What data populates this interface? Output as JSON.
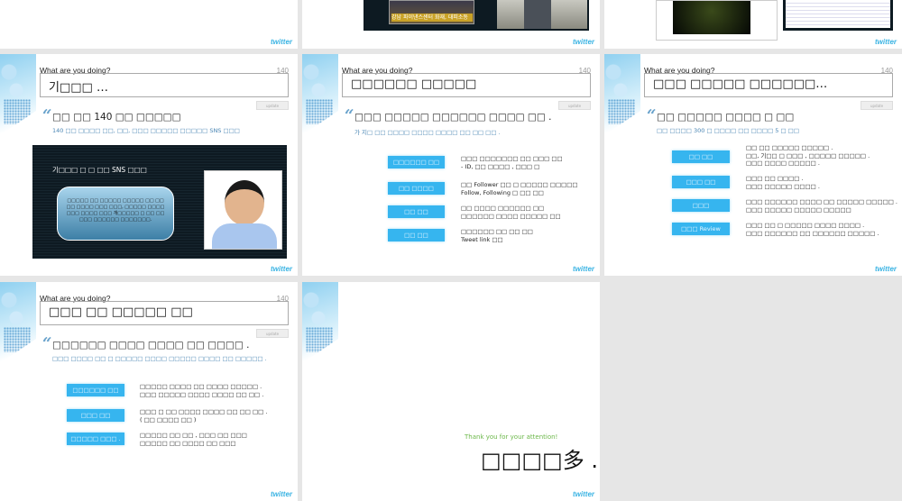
{
  "common": {
    "prompt": "What are you doing?",
    "counter": "140",
    "update": "update",
    "logo": "twitter"
  },
  "top_row": {
    "image_caption": "강남 파이낸스센터 화재, 대피소동"
  },
  "slide4": {
    "input": "기□□□ …",
    "heading": "□□ □□ 140 □□ □□□□□",
    "sub": "140 □□ □□□□ □□, □□, □□□ □□□□□ □□□□□ SNS □□□",
    "inner_title": "기□□□ □ □ □□ SNS □□□",
    "bubble": "□□□□□ □□ □□□□□ □□□□□ □□ □□ □□ □□□□ □□□ □□□, □□□□□ □□□□ □□□ □□□□ □□□ 개□□□□□ □ □□ □□ □□□ □□□□□□ □□□□□□□."
  },
  "slide5": {
    "input": "□□□□□□ □□□□□",
    "heading": "□□□ □□□□□ □□□□□□ □□□□ □□ .",
    "sub": "가 지□ □□ □□□□ □□□□ □□□□ □□ □□ □□ .",
    "rows": [
      {
        "btn": "□□□□□□ □□",
        "l1": "□□□ □□□□□□□ □□ □□□ □□",
        "l2": "- ID, □□ □□□□ , □□□ □"
      },
      {
        "btn": "□□ □□□□",
        "l1": "□□ Follower □□ □ □□□□□ □□□□□",
        "l2": "Follow, Following □ □□ □□"
      },
      {
        "btn": "□□ □□",
        "l1": "□□ □□□□ □□□□□□ □□",
        "l2": "□□□□□□ □□□□ □□□□□ □□"
      },
      {
        "btn": "□□ □□",
        "l1": "□□□□□□ □□ □□ □□",
        "l2": "Tweet link □□"
      }
    ]
  },
  "slide6": {
    "input": "□□□ □□□□□ □□□□□□…",
    "heading": "□□ □□□□□ □□□□ □ □□",
    "sub": "□□ □□□□ 300 □ □□□□ □□ □□□□ 5 □ □□",
    "rows": [
      {
        "btn": "□□ □□",
        "l1": "□□ □□ □□□□□ □□□□□ .",
        "l2": "□□, 기□□ □ □□□ , □□□□□ □□□□□ .",
        "l3": "□□□ □□□□ □□□□□ ."
      },
      {
        "btn": "□□□ □□",
        "l1": "□□□ □□ □□□□ .",
        "l2": "□□□ □□□□□ □□□□ ."
      },
      {
        "btn": "□□□",
        "l1": "□□□ □□□□□□ □□□□ □□ □□□□□ □□□□□ .",
        "l2": "□□□ □□□□□ □□□□□ □□□□□"
      },
      {
        "btn": "□□□ Review",
        "l1": "□□□ □□ □ □□□□□ □□□□ □□□□ .",
        "l2": "□□□ □□□□□□ □□ □□□□□□ □□□□□ ."
      }
    ]
  },
  "slide7": {
    "input": "□□□ □□ □□□□□ □□",
    "heading": "□□□□□□ □□□□ □□□□ □□ □□□□ .",
    "sub": "□□□ □□□□ □□ □ □□□□□ □□□□ □□□□□ □□□□ □□ □□□□□ .",
    "rows": [
      {
        "btn": "□□□□□□ □□",
        "l1": "□□□□□ □□□□ □□ □□□□ □□□□□ .",
        "l2": "□□□ □□□□□ □□□□ □□□□ □□ □□ ."
      },
      {
        "btn": "□□□ □□",
        "l1": "□□□ □ □□ □□□□ □□□□ □□ □□ □□ .",
        "l2": "( □□ □□□□ □□ )"
      },
      {
        "btn": "□□□□□ □□□ .",
        "l1": "□□□□□ □□ □□ , □□□ □□ □□□",
        "l2": "□□□□□ □□ □□□□ □□ □□□"
      }
    ]
  },
  "slide8": {
    "thanks": "Thank you for your attention!",
    "big": "□□□□多 ."
  }
}
